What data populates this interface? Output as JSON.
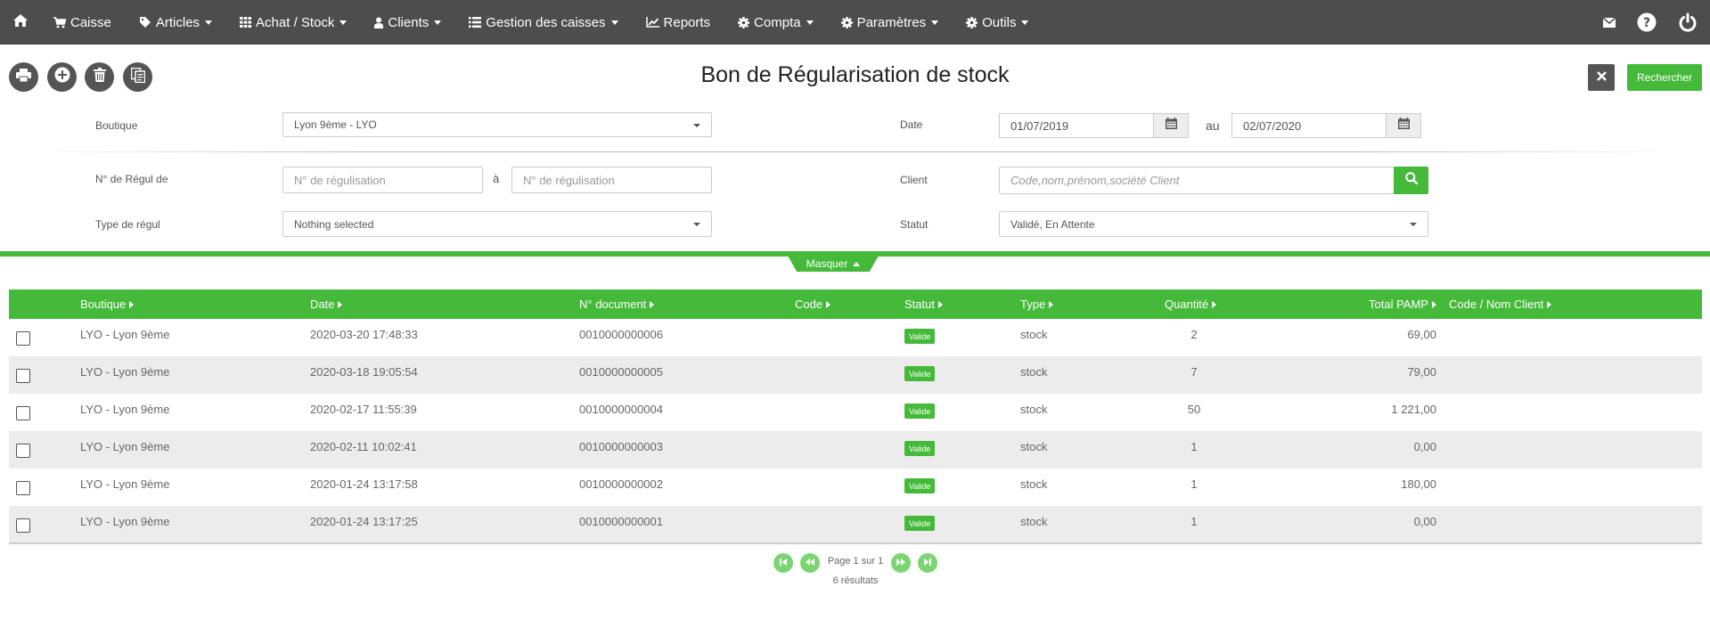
{
  "nav": {
    "items": [
      {
        "label": "Caisse",
        "icon": "cart-icon",
        "dropdown": false
      },
      {
        "label": "Articles",
        "icon": "tags-icon",
        "dropdown": true
      },
      {
        "label": "Achat / Stock",
        "icon": "grid-icon",
        "dropdown": true
      },
      {
        "label": "Clients",
        "icon": "user-icon",
        "dropdown": true
      },
      {
        "label": "Gestion des caisses",
        "icon": "list-icon",
        "dropdown": true
      },
      {
        "label": "Reports",
        "icon": "chart-icon",
        "dropdown": false
      },
      {
        "label": "Compta",
        "icon": "gear-icon",
        "dropdown": true
      },
      {
        "label": "Paramètres",
        "icon": "gear-icon",
        "dropdown": true
      },
      {
        "label": "Outils",
        "icon": "gear-icon",
        "dropdown": true
      }
    ]
  },
  "page": {
    "title": "Bon de Régularisation de stock",
    "search_label": "Rechercher"
  },
  "filters": {
    "boutique_label": "Boutique",
    "boutique_value": "Lyon 9ème - LYO",
    "date_label": "Date",
    "date_from": "01/07/2019",
    "date_to_label": "au",
    "date_to": "02/07/2020",
    "regul_label": "N° de Régul de",
    "regul_from_placeholder": "N° de régulisation",
    "regul_to_label": "à",
    "regul_to_placeholder": "N° de régulisation",
    "client_label": "Client",
    "client_placeholder": "Code,nom,prénom,société  Client",
    "type_label": "Type de régul",
    "type_value": "Nothing selected",
    "statut_label": "Statut",
    "statut_value": "Validé, En Attente",
    "toggle_label": "Masquer"
  },
  "table": {
    "headers": {
      "boutique": "Boutique",
      "date": "Date",
      "document": "N° document",
      "code": "Code",
      "statut": "Statut",
      "type": "Type",
      "quantite": "Quantité",
      "total": "Total PAMP",
      "client": "Code / Nom Client"
    },
    "rows": [
      {
        "boutique": "LYO - Lyon 9ème",
        "date": "2020-03-20 17:48:33",
        "document": "0010000000006",
        "code": "",
        "statut": "Valide",
        "type": "stock",
        "quantite": "2",
        "total": "69,00",
        "client": ""
      },
      {
        "boutique": "LYO - Lyon 9ème",
        "date": "2020-03-18 19:05:54",
        "document": "0010000000005",
        "code": "",
        "statut": "Valide",
        "type": "stock",
        "quantite": "7",
        "total": "79,00",
        "client": ""
      },
      {
        "boutique": "LYO - Lyon 9ème",
        "date": "2020-02-17 11:55:39",
        "document": "0010000000004",
        "code": "",
        "statut": "Valide",
        "type": "stock",
        "quantite": "50",
        "total": "1 221,00",
        "client": ""
      },
      {
        "boutique": "LYO - Lyon 9ème",
        "date": "2020-02-11 10:02:41",
        "document": "0010000000003",
        "code": "",
        "statut": "Valide",
        "type": "stock",
        "quantite": "1",
        "total": "0,00",
        "client": ""
      },
      {
        "boutique": "LYO - Lyon 9ème",
        "date": "2020-01-24 13:17:58",
        "document": "0010000000002",
        "code": "",
        "statut": "Valide",
        "type": "stock",
        "quantite": "1",
        "total": "180,00",
        "client": ""
      },
      {
        "boutique": "LYO - Lyon 9ème",
        "date": "2020-01-24 13:17:25",
        "document": "0010000000001",
        "code": "",
        "statut": "Valide",
        "type": "stock",
        "quantite": "1",
        "total": "0,00",
        "client": ""
      }
    ]
  },
  "pagination": {
    "page_text": "Page 1 sur 1",
    "results_text": "6 résultats"
  },
  "colors": {
    "navbar": "#4d4d4d",
    "accent_green": "#45b93a",
    "row_alt": "#ececec"
  }
}
